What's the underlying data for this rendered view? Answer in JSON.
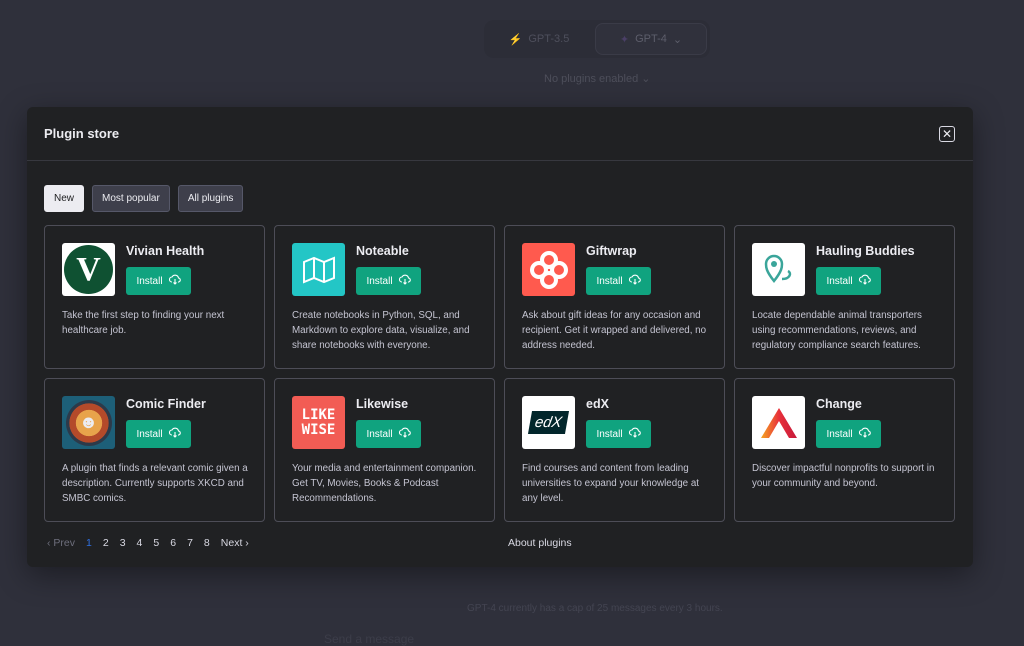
{
  "background": {
    "models": [
      {
        "label": "GPT-3.5",
        "icon": "lightning-icon"
      },
      {
        "label": "GPT-4",
        "icon": "puzzle-icon"
      }
    ],
    "plugins_status": "No plugins enabled",
    "cap_notice": "GPT-4 currently has a cap of 25 messages every 3 hours.",
    "send_placeholder": "Send a message"
  },
  "modal": {
    "title": "Plugin store",
    "filters": [
      "New",
      "Most popular",
      "All plugins"
    ],
    "install_label": "Install",
    "plugins": [
      {
        "name": "Vivian Health",
        "desc": "Take the first step to finding your next healthcare job."
      },
      {
        "name": "Noteable",
        "desc": "Create notebooks in Python, SQL, and Markdown to explore data, visualize, and share notebooks with everyone."
      },
      {
        "name": "Giftwrap",
        "desc": "Ask about gift ideas for any occasion and recipient. Get it wrapped and delivered, no address needed."
      },
      {
        "name": "Hauling Buddies",
        "desc": "Locate dependable animal transporters using recommendations, reviews, and regulatory compliance search features."
      },
      {
        "name": "Comic Finder",
        "desc": "A plugin that finds a relevant comic given a description. Currently supports XKCD and SMBC comics."
      },
      {
        "name": "Likewise",
        "desc": "Your media and entertainment companion. Get TV, Movies, Books & Podcast Recommendations.",
        "logo_text": [
          "LIKE",
          "WISE"
        ]
      },
      {
        "name": "edX",
        "desc": "Find courses and content from leading universities to expand your knowledge at any level.",
        "logo_text": "edX"
      },
      {
        "name": "Change",
        "desc": "Discover impactful nonprofits to support in your community and beyond."
      }
    ],
    "pagination": {
      "prev": "Prev",
      "next": "Next",
      "pages": [
        "1",
        "2",
        "3",
        "4",
        "5",
        "6",
        "7",
        "8"
      ],
      "current": "1"
    },
    "about": "About plugins"
  }
}
